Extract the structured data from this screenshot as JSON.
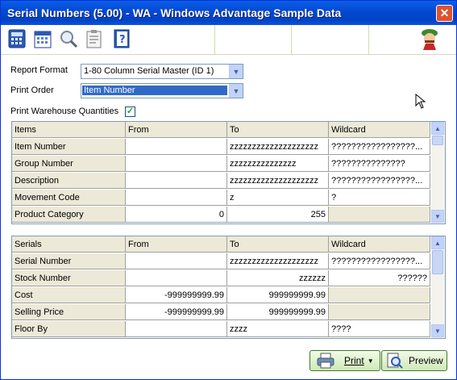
{
  "window": {
    "title": "Serial Numbers (5.00) - WA - Windows Advantage Sample Data"
  },
  "toolbar": {
    "icons": [
      "calculator-icon",
      "calendar-icon",
      "magnifier-icon",
      "clipboard-icon",
      "help-book-icon",
      "mascot-icon"
    ]
  },
  "form": {
    "report_format_label": "Report Format",
    "report_format_value": "1-80 Column Serial Master (ID 1)",
    "print_order_label": "Print Order",
    "print_order_value": "Item Number",
    "print_warehouse_label": "Print Warehouse Quantities",
    "print_warehouse_checked": "✓"
  },
  "items_grid": {
    "headers": [
      "Items",
      "From",
      "To",
      "Wildcard"
    ],
    "rows": [
      {
        "name": "Item Number",
        "from": "",
        "to": "zzzzzzzzzzzzzzzzzzzz",
        "wildcard": "?????????????????..."
      },
      {
        "name": "Group Number",
        "from": "",
        "to": "zzzzzzzzzzzzzzz",
        "wildcard": "???????????????"
      },
      {
        "name": "Description",
        "from": "",
        "to": "zzzzzzzzzzzzzzzzzzzz",
        "wildcard": "?????????????????..."
      },
      {
        "name": "Movement Code",
        "from": "",
        "to": "z",
        "wildcard": "?"
      },
      {
        "name": "Product Category",
        "from": "0",
        "to": "255",
        "wildcard": ""
      }
    ]
  },
  "serials_grid": {
    "headers": [
      "Serials",
      "From",
      "To",
      "Wildcard"
    ],
    "rows": [
      {
        "name": "Serial Number",
        "from": "",
        "to": "zzzzzzzzzzzzzzzzzzzz",
        "wildcard": "?????????????????..."
      },
      {
        "name": "Stock Number",
        "from": "",
        "to": "zzzzzz",
        "wildcard": "??????"
      },
      {
        "name": "Cost",
        "from": "-999999999.99",
        "to": "999999999.99",
        "wildcard": ""
      },
      {
        "name": "Selling Price",
        "from": "-999999999.99",
        "to": "999999999.99",
        "wildcard": ""
      },
      {
        "name": "Floor By",
        "from": "",
        "to": "zzzz",
        "wildcard": "????"
      }
    ]
  },
  "buttons": {
    "print": "Print",
    "preview": "Preview"
  }
}
